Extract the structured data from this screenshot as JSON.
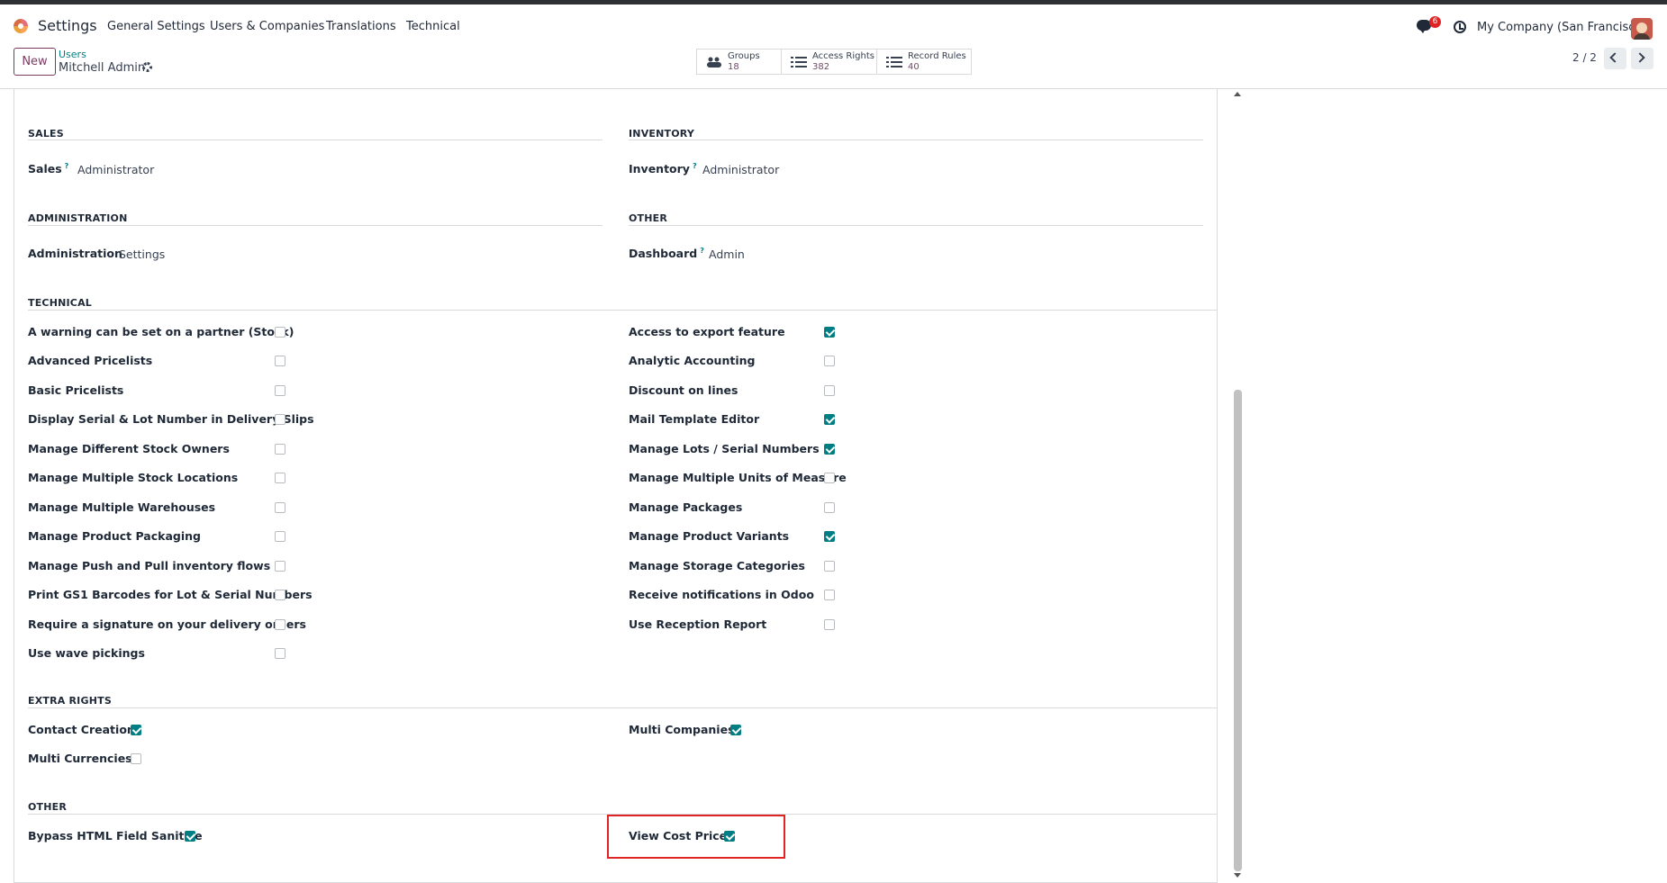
{
  "nav": {
    "app": "Settings",
    "menus": [
      "General Settings",
      "Users & Companies",
      "Translations",
      "Technical"
    ],
    "badge": "6",
    "company": "My Company (San Francisco)"
  },
  "control": {
    "new_label": "New",
    "breadcrumb_parent": "Users",
    "record": "Mitchell Admin",
    "smart": [
      {
        "label": "Groups",
        "count": "18"
      },
      {
        "label": "Access Rights",
        "count": "382"
      },
      {
        "label": "Record Rules",
        "count": "40"
      }
    ],
    "pager": "2 / 2"
  },
  "sections": {
    "sales": "SALES",
    "inventory": "INVENTORY",
    "administration": "ADMINISTRATION",
    "other_top": "OTHER",
    "technical": "TECHNICAL",
    "extra": "EXTRA RIGHTS",
    "other_bottom": "OTHER"
  },
  "fields": {
    "sales": {
      "label": "Sales",
      "value": "Administrator"
    },
    "inventory": {
      "label": "Inventory",
      "value": "Administrator"
    },
    "administration": {
      "label": "Administration",
      "value": "Settings"
    },
    "dashboard": {
      "label": "Dashboard",
      "value": "Admin"
    }
  },
  "technical_left": [
    {
      "label": "A warning can be set on a partner (Stock)",
      "checked": false
    },
    {
      "label": "Advanced Pricelists",
      "checked": false
    },
    {
      "label": "Basic Pricelists",
      "checked": false
    },
    {
      "label": "Display Serial & Lot Number in Delivery Slips",
      "checked": false
    },
    {
      "label": "Manage Different Stock Owners",
      "checked": false
    },
    {
      "label": "Manage Multiple Stock Locations",
      "checked": false
    },
    {
      "label": "Manage Multiple Warehouses",
      "checked": false
    },
    {
      "label": "Manage Product Packaging",
      "checked": false
    },
    {
      "label": "Manage Push and Pull inventory flows",
      "checked": false
    },
    {
      "label": "Print GS1 Barcodes for Lot & Serial Numbers",
      "checked": false
    },
    {
      "label": "Require a signature on your delivery orders",
      "checked": false
    },
    {
      "label": "Use wave pickings",
      "checked": false
    }
  ],
  "technical_right": [
    {
      "label": "Access to export feature",
      "checked": true
    },
    {
      "label": "Analytic Accounting",
      "checked": false
    },
    {
      "label": "Discount on lines",
      "checked": false
    },
    {
      "label": "Mail Template Editor",
      "checked": true
    },
    {
      "label": "Manage Lots / Serial Numbers",
      "checked": true
    },
    {
      "label": "Manage Multiple Units of Measure",
      "checked": false
    },
    {
      "label": "Manage Packages",
      "checked": false
    },
    {
      "label": "Manage Product Variants",
      "checked": true
    },
    {
      "label": "Manage Storage Categories",
      "checked": false
    },
    {
      "label": "Receive notifications in Odoo",
      "checked": false
    },
    {
      "label": "Use Reception Report",
      "checked": false
    }
  ],
  "extra_left": [
    {
      "label": "Contact Creation",
      "checked": true
    },
    {
      "label": "Multi Currencies",
      "checked": false
    }
  ],
  "extra_right": [
    {
      "label": "Multi Companies",
      "checked": true
    }
  ],
  "other_left": [
    {
      "label": "Bypass HTML Field Sanitize",
      "checked": true
    }
  ],
  "other_right": [
    {
      "label": "View Cost Price",
      "checked": true
    }
  ],
  "colors": {
    "accent": "#017e84",
    "brand": "#714b67",
    "highlight": "#e02424"
  }
}
